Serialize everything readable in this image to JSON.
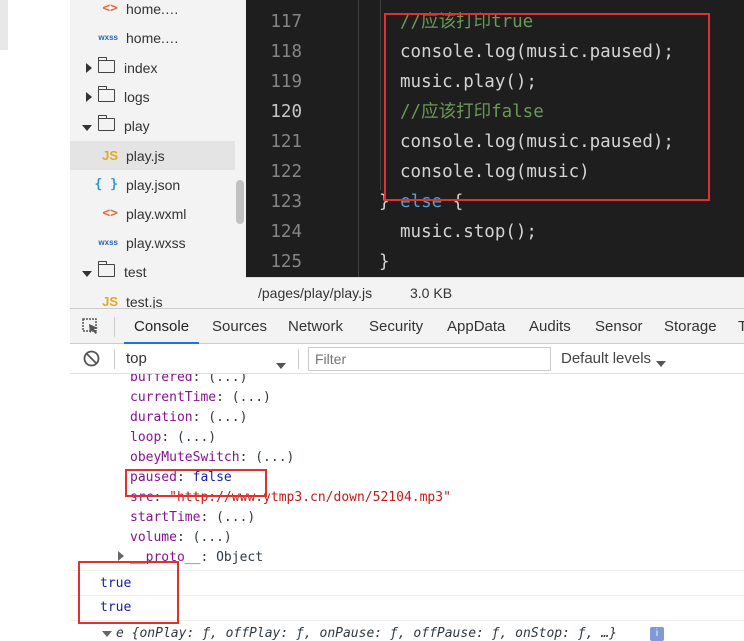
{
  "tree": {
    "items": [
      {
        "icon": "html",
        "label": "home.…"
      },
      {
        "icon": "wxss",
        "label": "home.…"
      },
      {
        "icon": "folder",
        "label": "index"
      },
      {
        "icon": "folder",
        "label": "logs"
      },
      {
        "icon": "folder-open",
        "label": "play"
      },
      {
        "icon": "js",
        "label": "play.js"
      },
      {
        "icon": "json",
        "label": "play.json"
      },
      {
        "icon": "html",
        "label": "play.wxml"
      },
      {
        "icon": "wxss",
        "label": "play.wxss"
      },
      {
        "icon": "folder-open",
        "label": "test"
      },
      {
        "icon": "js",
        "label": "test.js"
      }
    ],
    "icon_text": {
      "html": "<>",
      "wxss": "wxss",
      "js": "JS",
      "json": "{ }"
    }
  },
  "editor": {
    "lines": [
      {
        "num": "117",
        "code": "//应该打印true"
      },
      {
        "num": "118",
        "code": "console.log(music.paused);"
      },
      {
        "num": "119",
        "code": "music.play();"
      },
      {
        "num": "120",
        "code": "//应该打印false"
      },
      {
        "num": "121",
        "code": "console.log(music.paused);"
      },
      {
        "num": "122",
        "code": "console.log(music)"
      },
      {
        "num": "123",
        "code_kw1": "} ",
        "code_kw2": "else",
        "code_rest": " {"
      },
      {
        "num": "124",
        "code": "music.stop();"
      },
      {
        "num": "125",
        "code": "}"
      }
    ]
  },
  "status": {
    "path": "/pages/play/play.js",
    "size": "3.0 KB"
  },
  "devtools": {
    "tabs": [
      "Console",
      "Sources",
      "Network",
      "Security",
      "AppData",
      "Audits",
      "Sensor",
      "Storage",
      "T"
    ],
    "context": "top",
    "filter_placeholder": "Filter",
    "levels": "Default levels"
  },
  "console": {
    "props": [
      {
        "key": "buffered",
        "val": "(...)"
      },
      {
        "key": "currentTime",
        "val": "(...)"
      },
      {
        "key": "duration",
        "val": "(...)"
      },
      {
        "key": "loop",
        "val": "(...)"
      },
      {
        "key": "obeyMuteSwitch",
        "val": "(...)"
      },
      {
        "key": "paused",
        "val": "false"
      },
      {
        "key": "src",
        "val": "\"http://www.ytmp3.cn/down/52104.mp3\""
      },
      {
        "key": "startTime",
        "val": "(...)"
      },
      {
        "key": "volume",
        "val": "(...)"
      },
      {
        "key": "__proto__",
        "val": "Object"
      }
    ],
    "logs": [
      "true",
      "true"
    ],
    "object_summary": "e {onPlay: ƒ, offPlay: ƒ, onPause: ƒ, offPause: ƒ, onStop: ƒ, …}",
    "info_badge": "i"
  },
  "colors": {
    "highlight_box": "#e03131",
    "active_tab": "#1a73e8"
  }
}
